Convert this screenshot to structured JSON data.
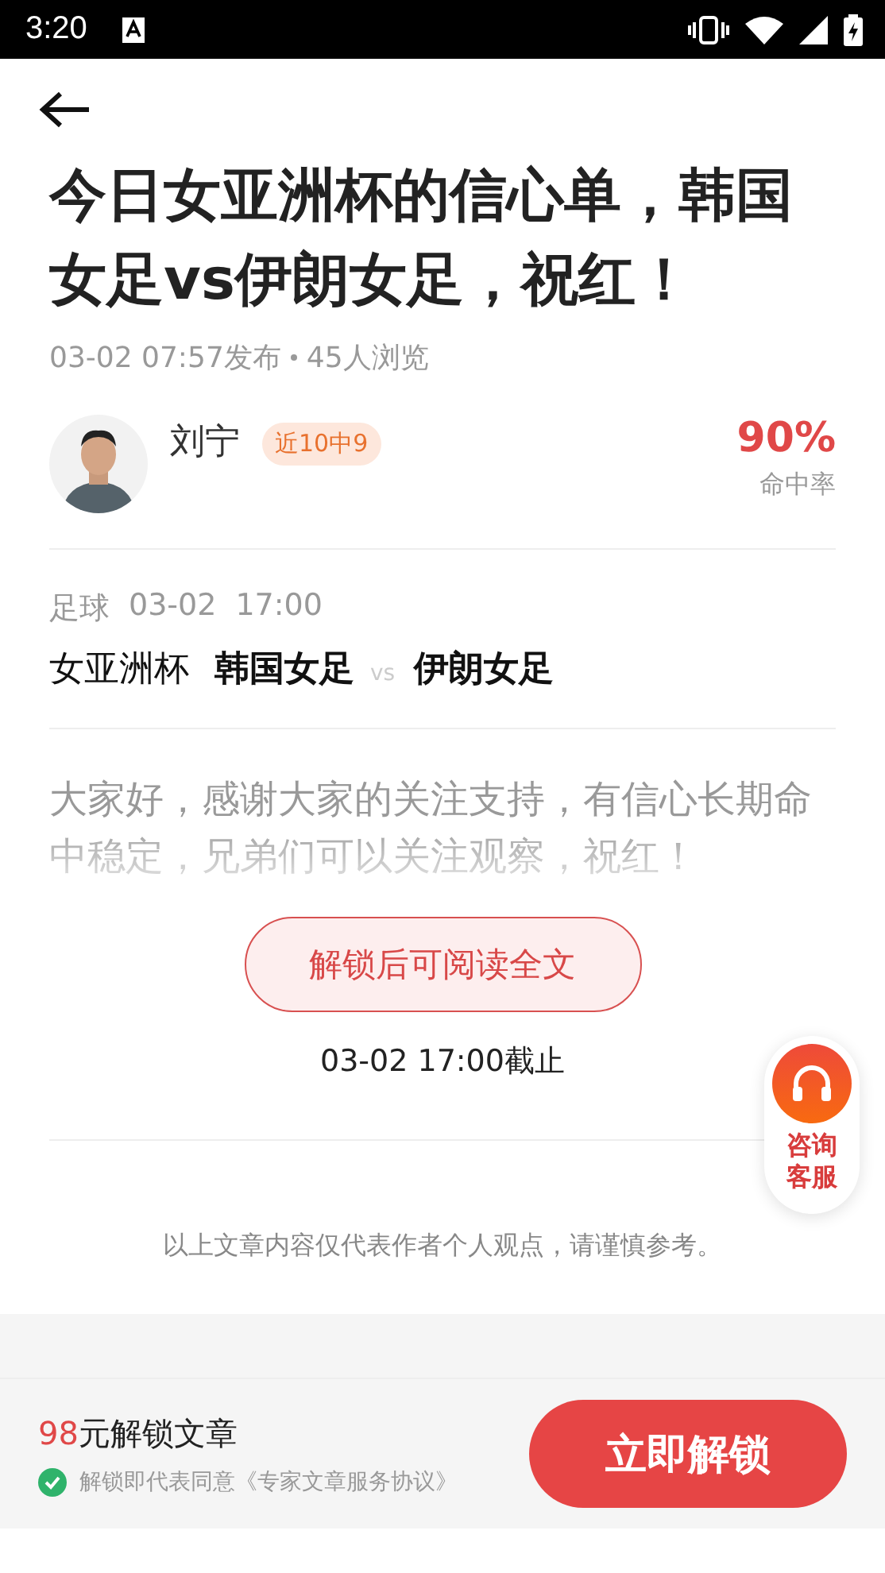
{
  "status_bar": {
    "time": "3:20"
  },
  "article": {
    "title": "今日女亚洲杯的信心单，韩国女足vs伊朗女足，祝红！",
    "published": "03-02 07:57发布",
    "views": "45人浏览"
  },
  "author": {
    "name": "刘宁",
    "badge": "近10中9",
    "rate": "90%",
    "rate_label": "命中率"
  },
  "match": {
    "sport": "足球",
    "date": "03-02",
    "time": "17:00",
    "league": "女亚洲杯",
    "home": "韩国女足",
    "vs": "vs",
    "away": "伊朗女足"
  },
  "preview": "大家好，感谢大家的关注支持，有信心长期命中稳定，兄弟们可以关注观察，祝红！",
  "unlock_button": "解锁后可阅读全文",
  "deadline": "03-02 17:00截止",
  "disclaimer": "以上文章内容仅代表作者个人观点，请谨慎参考。",
  "support": {
    "label": "咨询客服"
  },
  "footer": {
    "price": "98",
    "price_label": "元解锁文章",
    "agreed": true,
    "agreement": "解锁即代表同意《专家文章服务协议》",
    "button": "立即解锁"
  }
}
